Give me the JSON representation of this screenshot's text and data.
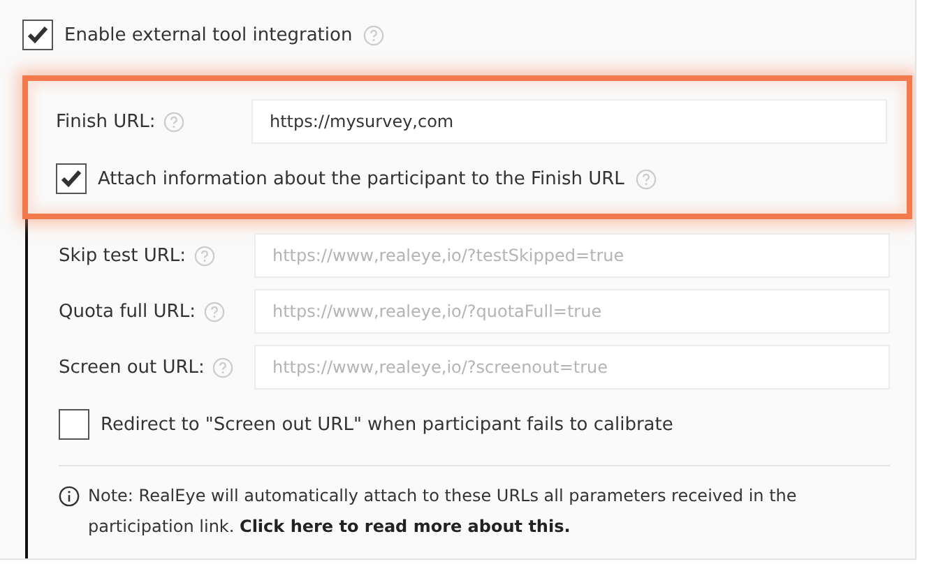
{
  "enable": {
    "label": "Enable external tool integration",
    "checked": true
  },
  "highlighted": {
    "field": {
      "label": "Finish URL:",
      "value": "https://mysurvey,com"
    },
    "checkbox": {
      "label": "Attach information about the participant to the Finish URL",
      "checked": true
    }
  },
  "fields": [
    {
      "label": "Skip test URL:",
      "placeholder": "https://www,realeye,io/?testSkipped=true"
    },
    {
      "label": "Quota full URL:",
      "placeholder": "https://www,realeye,io/?quotaFull=true"
    },
    {
      "label": "Screen out URL:",
      "placeholder": "https://www,realeye,io/?screenout=true"
    }
  ],
  "redirect": {
    "label": "Redirect to \"Screen out URL\" when participant fails to calibrate",
    "checked": false
  },
  "note": {
    "text": "Note: RealEye will automatically attach to these URLs all parameters received in the participation link.",
    "link": "Click here to read more about this."
  }
}
